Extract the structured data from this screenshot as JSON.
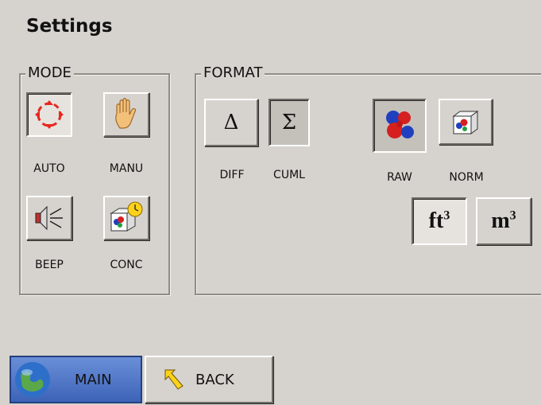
{
  "header": {
    "title": "Settings"
  },
  "mode": {
    "label": "MODE",
    "buttons": {
      "auto": "AUTO",
      "manu": "MANU",
      "beep": "BEEP",
      "conc": "CONC"
    }
  },
  "format": {
    "label": "FORMAT",
    "buttons": {
      "diff": "DIFF",
      "cuml": "CUML",
      "raw": "RAW",
      "norm": "NORM"
    },
    "symbols": {
      "delta": "Δ",
      "sigma": "Σ"
    },
    "units": {
      "ft": "ft",
      "m": "m",
      "exp": "3"
    }
  },
  "nav": {
    "main": "MAIN",
    "back": "BACK"
  },
  "colors": {
    "main_button": "#4a70c4",
    "auto_icon": "#e8281f",
    "raw_sphere": "#d62020"
  }
}
